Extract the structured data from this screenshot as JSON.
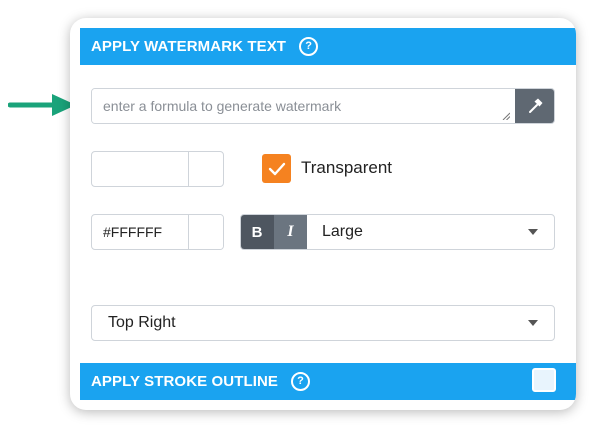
{
  "colors": {
    "header_bg": "#1aa3f0",
    "checkbox": "#f58220",
    "button_dark": "#5f6872",
    "arrow": "#1aa37a"
  },
  "watermark": {
    "header_title": "APPLY WATERMARK TEXT",
    "help_glyph": "?",
    "formula_placeholder": "enter a formula to generate watermark",
    "formula_value": "",
    "formula_button_icon": "hammer-icon",
    "opacity_value": "",
    "transparent_checked": true,
    "transparent_label": "Transparent",
    "color_value": "#FFFFFF",
    "bold_label": "B",
    "italic_label": "I",
    "font_size": "Large",
    "position": "Top Right"
  },
  "stroke": {
    "header_title": "APPLY STROKE OUTLINE",
    "help_glyph": "?",
    "enabled": false
  }
}
